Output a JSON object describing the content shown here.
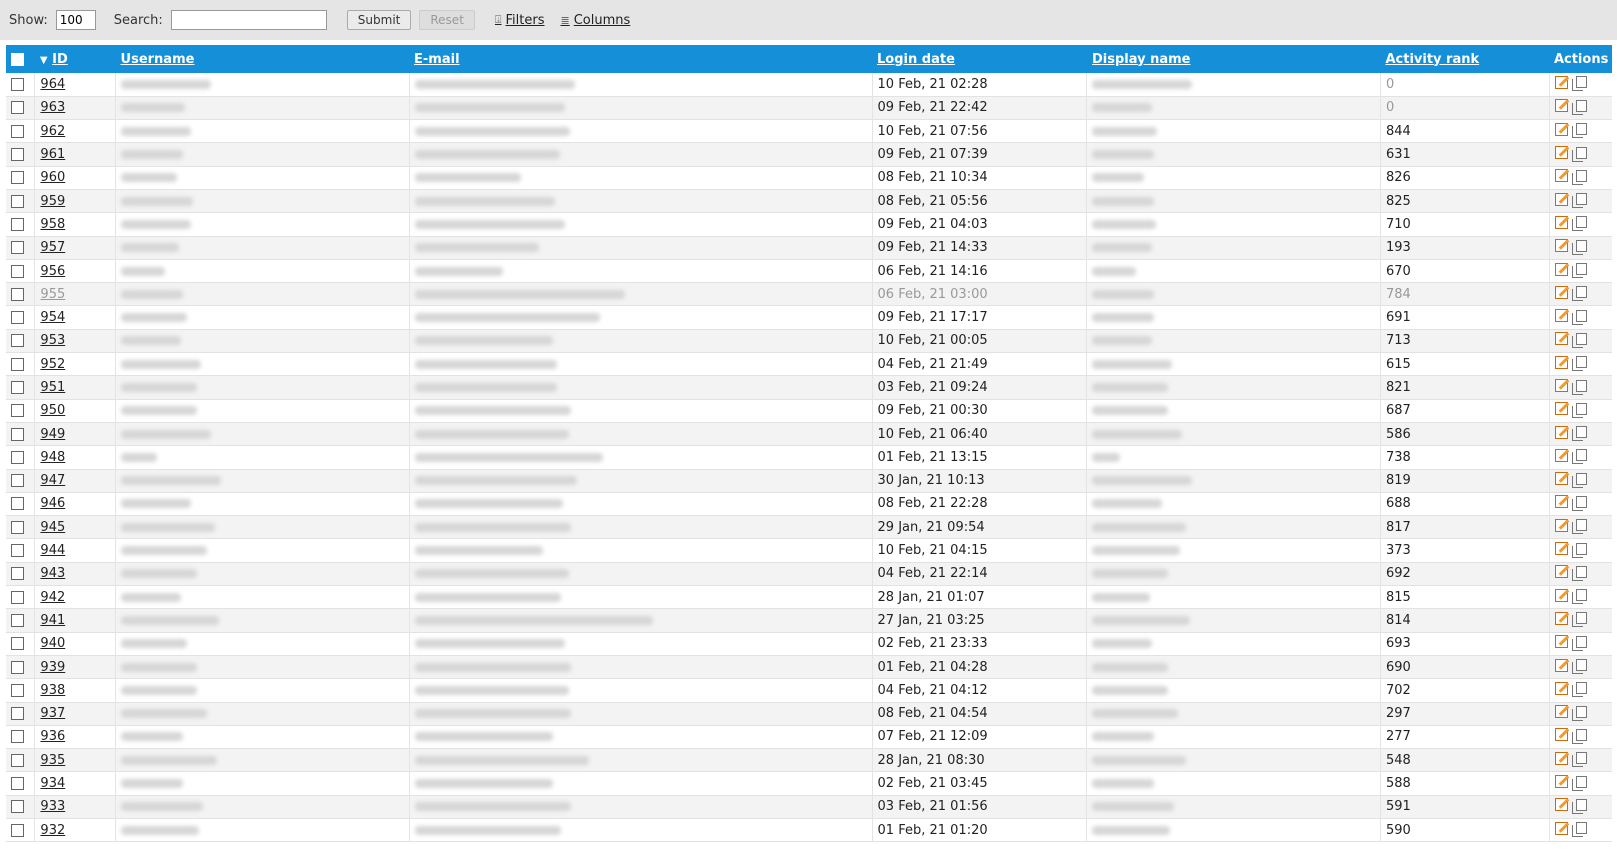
{
  "toolbar": {
    "show_label": "Show:",
    "show_value": "100",
    "search_label": "Search:",
    "search_value": "",
    "submit_label": "Submit",
    "reset_label": "Reset",
    "filters_label": "Filters",
    "columns_label": "Columns"
  },
  "columns": {
    "id": "ID",
    "username": "Username",
    "email": "E-mail",
    "login_date": "Login date",
    "display_name": "Display name",
    "activity_rank": "Activity rank",
    "actions": "Actions"
  },
  "rows": [
    {
      "id": "964",
      "login": "10 Feb, 21 02:28",
      "rank": "0"
    },
    {
      "id": "963",
      "login": "09 Feb, 21 22:42",
      "rank": "0"
    },
    {
      "id": "962",
      "login": "10 Feb, 21 07:56",
      "rank": "844"
    },
    {
      "id": "961",
      "login": "09 Feb, 21 07:39",
      "rank": "631"
    },
    {
      "id": "960",
      "login": "08 Feb, 21 10:34",
      "rank": "826"
    },
    {
      "id": "959",
      "login": "08 Feb, 21 05:56",
      "rank": "825"
    },
    {
      "id": "958",
      "login": "09 Feb, 21 04:03",
      "rank": "710"
    },
    {
      "id": "957",
      "login": "09 Feb, 21 14:33",
      "rank": "193"
    },
    {
      "id": "956",
      "login": "06 Feb, 21 14:16",
      "rank": "670"
    },
    {
      "id": "955",
      "login": "06 Feb, 21 03:00",
      "rank": "784"
    },
    {
      "id": "954",
      "login": "09 Feb, 21 17:17",
      "rank": "691"
    },
    {
      "id": "953",
      "login": "10 Feb, 21 00:05",
      "rank": "713"
    },
    {
      "id": "952",
      "login": "04 Feb, 21 21:49",
      "rank": "615"
    },
    {
      "id": "951",
      "login": "03 Feb, 21 09:24",
      "rank": "821"
    },
    {
      "id": "950",
      "login": "09 Feb, 21 00:30",
      "rank": "687"
    },
    {
      "id": "949",
      "login": "10 Feb, 21 06:40",
      "rank": "586"
    },
    {
      "id": "948",
      "login": "01 Feb, 21 13:15",
      "rank": "738"
    },
    {
      "id": "947",
      "login": "30 Jan, 21 10:13",
      "rank": "819"
    },
    {
      "id": "946",
      "login": "08 Feb, 21 22:28",
      "rank": "688"
    },
    {
      "id": "945",
      "login": "29 Jan, 21 09:54",
      "rank": "817"
    },
    {
      "id": "944",
      "login": "10 Feb, 21 04:15",
      "rank": "373"
    },
    {
      "id": "943",
      "login": "04 Feb, 21 22:14",
      "rank": "692"
    },
    {
      "id": "942",
      "login": "28 Jan, 21 01:07",
      "rank": "815"
    },
    {
      "id": "941",
      "login": "27 Jan, 21 03:25",
      "rank": "814"
    },
    {
      "id": "940",
      "login": "02 Feb, 21 23:33",
      "rank": "693"
    },
    {
      "id": "939",
      "login": "01 Feb, 21 04:28",
      "rank": "690"
    },
    {
      "id": "938",
      "login": "04 Feb, 21 04:12",
      "rank": "702"
    },
    {
      "id": "937",
      "login": "08 Feb, 21 04:54",
      "rank": "297"
    },
    {
      "id": "936",
      "login": "07 Feb, 21 12:09",
      "rank": "277"
    },
    {
      "id": "935",
      "login": "28 Jan, 21 08:30",
      "rank": "548"
    },
    {
      "id": "934",
      "login": "02 Feb, 21 03:45",
      "rank": "588"
    },
    {
      "id": "933",
      "login": "03 Feb, 21 01:56",
      "rank": "591"
    },
    {
      "id": "932",
      "login": "01 Feb, 21 01:20",
      "rank": "590"
    }
  ],
  "colors": {
    "header_bg": "#168fd9",
    "toolbar_bg": "#e5e5e5",
    "edit_icon": "#f19b2c"
  }
}
